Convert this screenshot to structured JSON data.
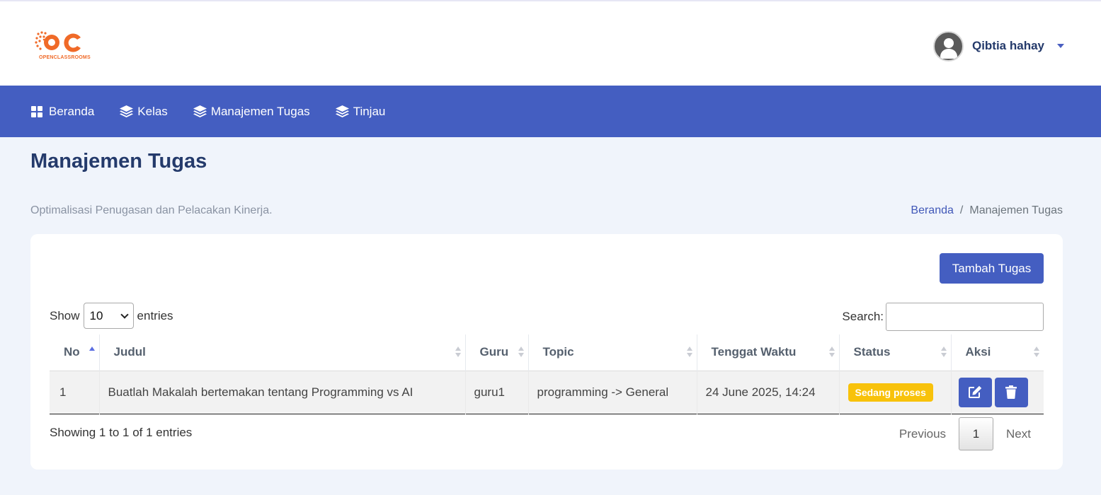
{
  "brand": {
    "logo_text": "OC",
    "logo_subtext": "OPENCLASSROOMS",
    "color": "#f06a28"
  },
  "user": {
    "name": "Qibtia hahay"
  },
  "nav": {
    "items": [
      {
        "label": "Beranda",
        "icon": "grid-icon"
      },
      {
        "label": "Kelas",
        "icon": "layers-icon"
      },
      {
        "label": "Manajemen Tugas",
        "icon": "layers-icon"
      },
      {
        "label": "Tinjau",
        "icon": "layers-icon"
      }
    ],
    "color": "#445ec1"
  },
  "page": {
    "title": "Manajemen Tugas",
    "subtitle": "Optimalisasi Penugasan dan Pelacakan Kinerja.",
    "breadcrumb": {
      "home": "Beranda",
      "separator": "/",
      "current": "Manajemen Tugas"
    }
  },
  "toolbar": {
    "add_label": "Tambah Tugas"
  },
  "datatable": {
    "show_label": "Show",
    "entries_value": "10",
    "entries_label": "entries",
    "search_label": "Search:",
    "search_value": "",
    "columns": [
      "No",
      "Judul",
      "Guru",
      "Topic",
      "Tenggat Waktu",
      "Status",
      "Aksi"
    ],
    "sorted_column": "No",
    "rows": [
      {
        "no": "1",
        "judul": "Buatlah Makalah bertemakan tentang Programming vs AI",
        "guru": "guru1",
        "topic": "programming -> General",
        "tenggat": "24 June 2025, 14:24",
        "status": "Sedang proses",
        "status_color": "#f8c20b",
        "actions": [
          "edit-icon",
          "trash-icon"
        ]
      }
    ],
    "info": "Showing 1 to 1 of 1 entries",
    "pagination": {
      "previous": "Previous",
      "current": "1",
      "next": "Next"
    }
  }
}
